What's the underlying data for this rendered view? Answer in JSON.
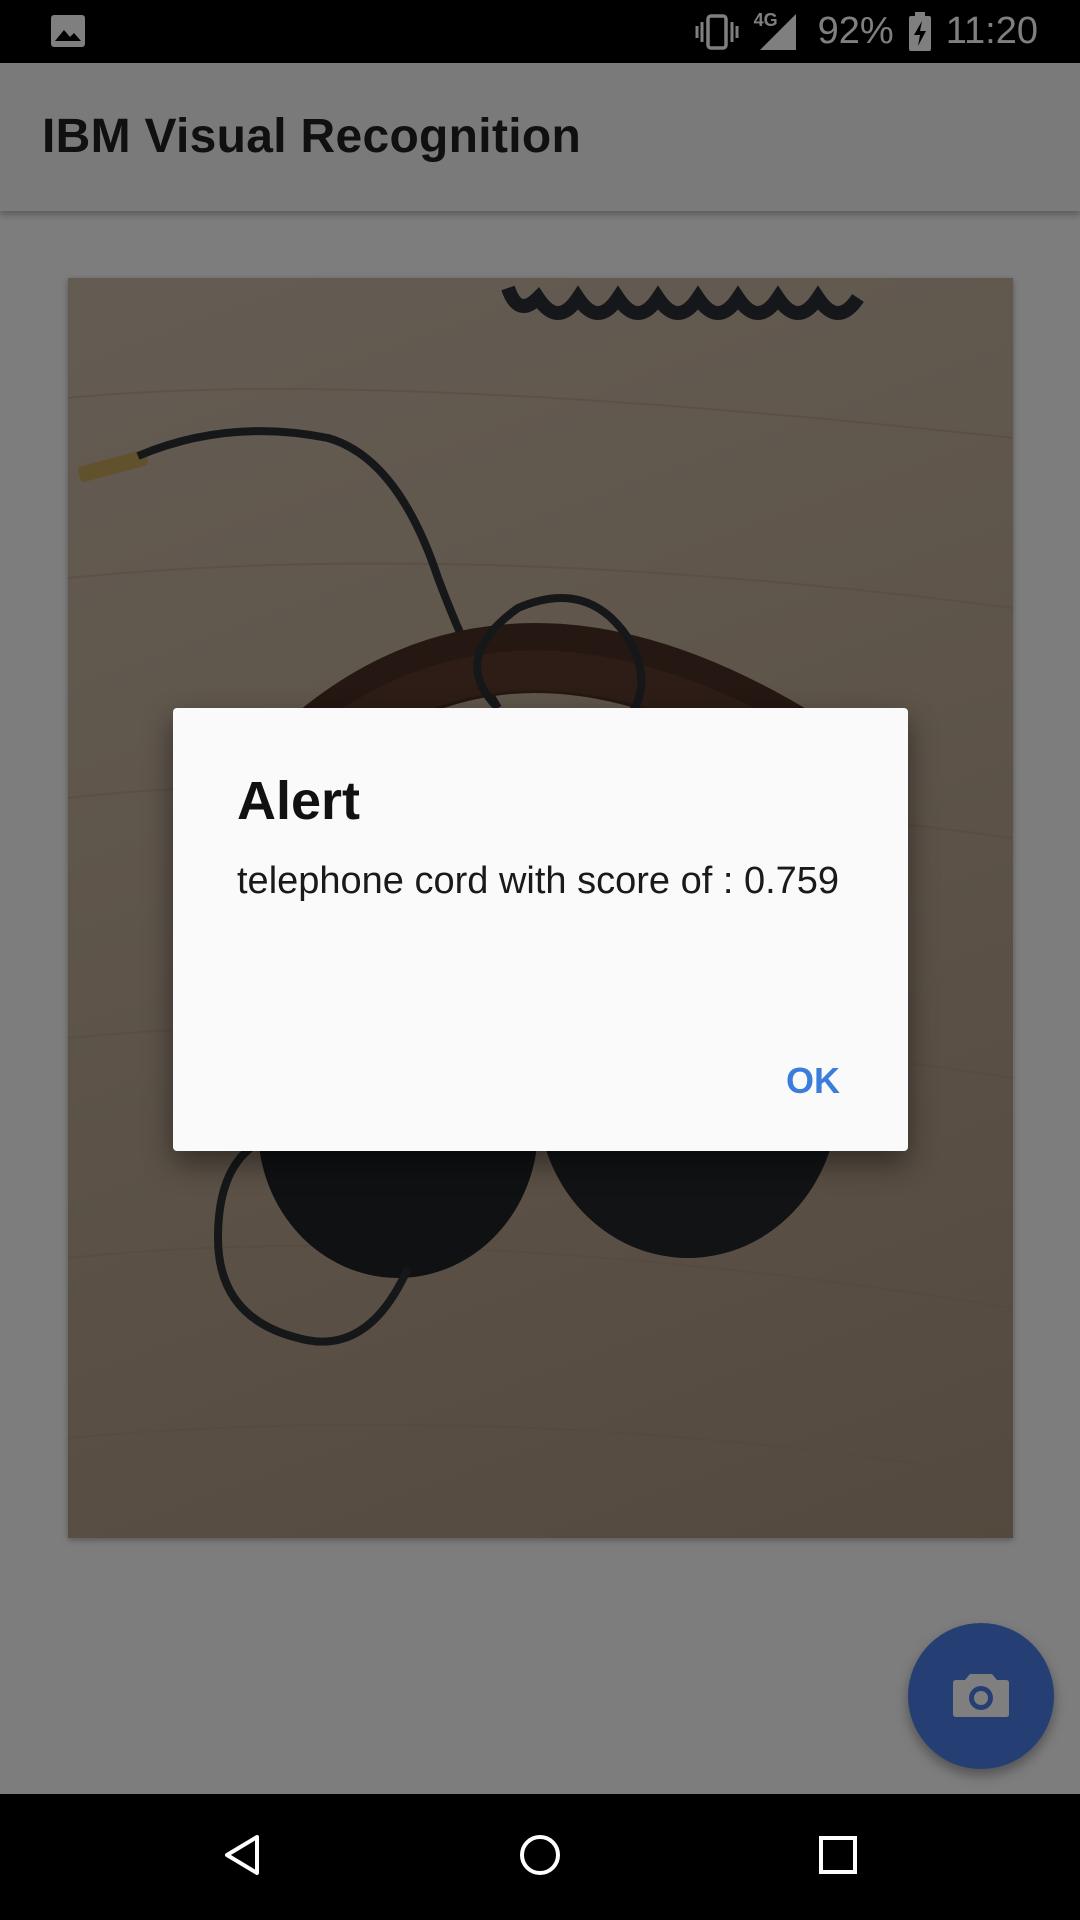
{
  "status_bar": {
    "network": "4G",
    "battery": "92%",
    "time": "11:20"
  },
  "app": {
    "title": "IBM Visual Recognition",
    "fab_icon": "camera-icon"
  },
  "dialog": {
    "title": "Alert",
    "message": "telephone cord with score of : 0.759",
    "ok_label": "OK"
  },
  "colors": {
    "accent": "#4a7fe8",
    "dialog_button": "#3b7ddd",
    "scrim": "rgba(0,0,0,0.5)"
  }
}
